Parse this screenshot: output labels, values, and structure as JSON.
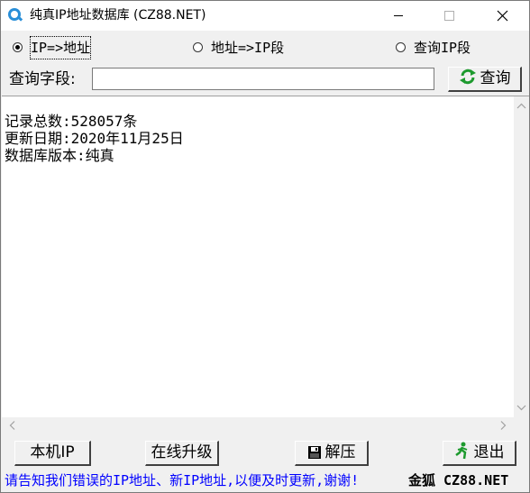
{
  "window": {
    "title": "纯真IP地址数据库 (CZ88.NET)",
    "icon": "search-magnifier-icon"
  },
  "mode_options": [
    {
      "label": "IP=>地址",
      "selected": true
    },
    {
      "label": "地址=>IP段",
      "selected": false
    },
    {
      "label": "查询IP段",
      "selected": false
    }
  ],
  "query": {
    "label": "查询字段:",
    "value": "",
    "button_label": "查询",
    "button_icon": "refresh-icon"
  },
  "result": {
    "lines": [
      "记录总数:528057条",
      "更新日期:2020年11月25日",
      "数据库版本:纯真"
    ]
  },
  "buttons": {
    "local_ip": "本机IP",
    "online_upgrade": "在线升级",
    "unzip": "解压",
    "unzip_icon": "floppy-disk-icon",
    "exit": "退出",
    "exit_icon": "running-man-icon"
  },
  "footer": {
    "note": "请告知我们错误的IP地址、新IP地址,以便及时更新,谢谢!",
    "brand": "金狐 CZ88.NET",
    "note_color": "#0000ff"
  }
}
